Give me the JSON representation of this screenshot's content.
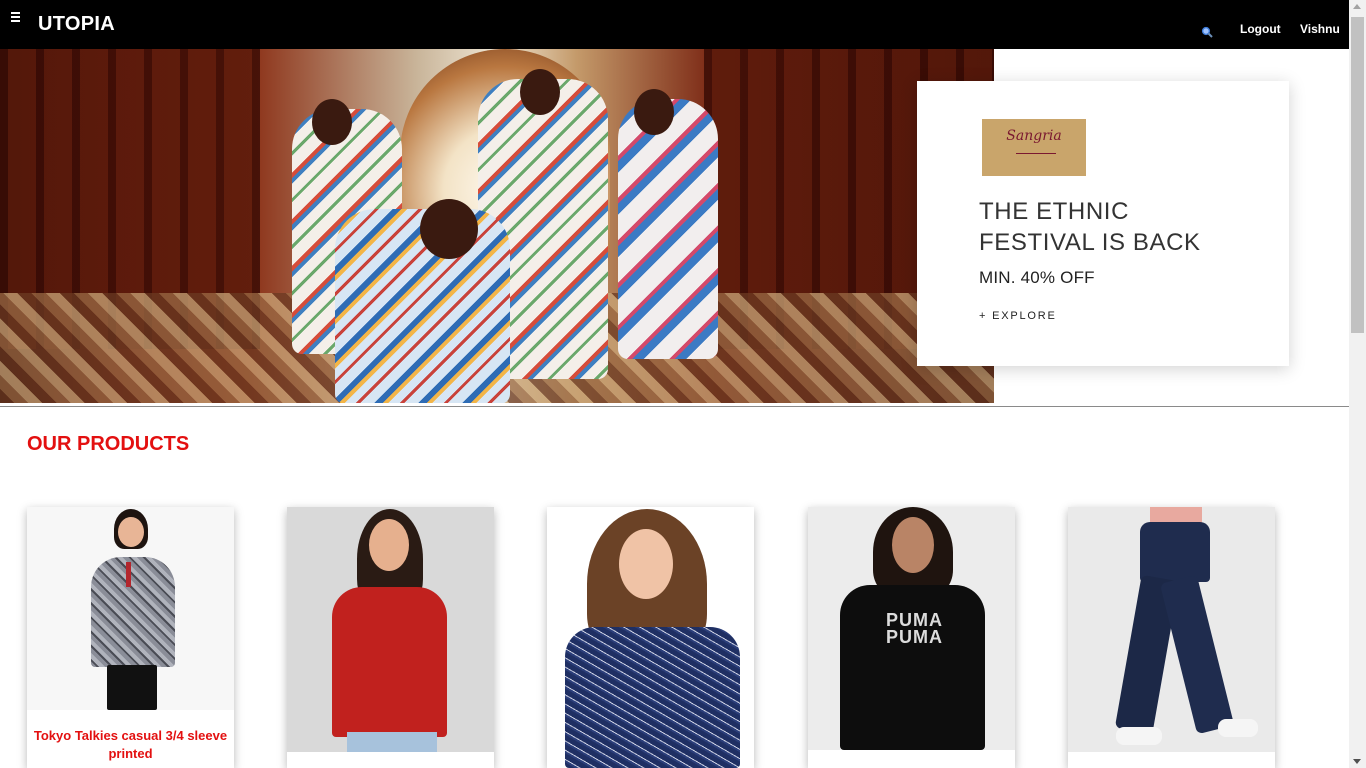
{
  "navbar": {
    "menu_icon": "hamburger-menu-icon",
    "brand": "UTOPIA",
    "search_icon": "search-icon",
    "logout_label": "Logout",
    "user_label": "Vishnu"
  },
  "hero": {
    "logo_text": "Sangria",
    "title_line1": "THE ETHNIC",
    "title_line2": "FESTIVAL IS BACK",
    "offer": "MIN. 40% OFF",
    "explore_label": "+ EXPLORE"
  },
  "products": {
    "title": "OUR PRODUCTS",
    "items": [
      {
        "name": "Tokyo Talkies casual 3/4 sleeve printed"
      },
      {
        "name": ""
      },
      {
        "name": ""
      },
      {
        "name": ""
      },
      {
        "name": ""
      }
    ]
  },
  "colors": {
    "navbar_bg": "#000000",
    "accent_red": "#e31010"
  }
}
